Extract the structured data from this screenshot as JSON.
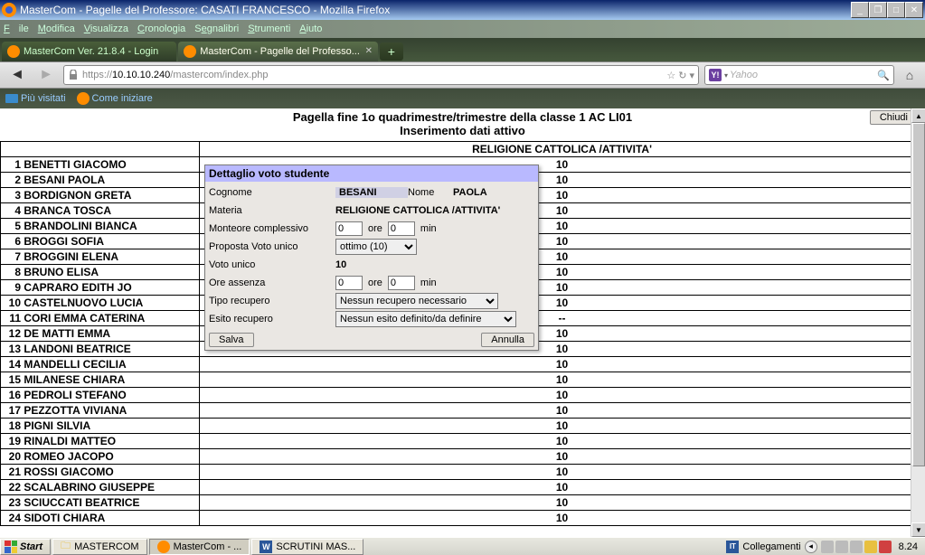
{
  "window": {
    "title": "MasterCom - Pagelle del Professore: CASATI FRANCESCO - Mozilla Firefox"
  },
  "menu": {
    "file": "File",
    "modifica": "Modifica",
    "visualizza": "Visualizza",
    "cronologia": "Cronologia",
    "segnalibri": "Segnalibri",
    "strumenti": "Strumenti",
    "aiuto": "Aiuto"
  },
  "tabs": {
    "t1": "MasterCom Ver. 21.8.4 - Login",
    "t2": "MasterCom - Pagelle del Professo..."
  },
  "nav": {
    "url_pre": "https://",
    "url_bold": "10.10.10.240",
    "url_post": "/mastercom/index.php",
    "search_engine": "Yahoo"
  },
  "bookmarks": {
    "most": "Più visitati",
    "start": "Come iniziare"
  },
  "page": {
    "title1": "Pagella fine 1o quadrimestre/trimestre della classe 1 AC LI01",
    "title2": "Inserimento dati attivo",
    "close_btn": "Chiudi",
    "col_header": "RELIGIONE CATTOLICA /ATTIVITA'",
    "students": [
      {
        "n": "1",
        "name": "BENETTI GIACOMO",
        "v": "10"
      },
      {
        "n": "2",
        "name": "BESANI PAOLA",
        "v": "10"
      },
      {
        "n": "3",
        "name": "BORDIGNON GRETA",
        "v": "10"
      },
      {
        "n": "4",
        "name": "BRANCA TOSCA",
        "v": "10"
      },
      {
        "n": "5",
        "name": "BRANDOLINI BIANCA",
        "v": "10"
      },
      {
        "n": "6",
        "name": "BROGGI SOFIA",
        "v": "10"
      },
      {
        "n": "7",
        "name": "BROGGINI ELENA",
        "v": "10"
      },
      {
        "n": "8",
        "name": "BRUNO ELISA",
        "v": "10"
      },
      {
        "n": "9",
        "name": "CAPRARO EDITH JO",
        "v": "10"
      },
      {
        "n": "10",
        "name": "CASTELNUOVO LUCIA",
        "v": "10"
      },
      {
        "n": "11",
        "name": "CORI EMMA CATERINA",
        "v": "--"
      },
      {
        "n": "12",
        "name": "DE MATTI EMMA",
        "v": "10"
      },
      {
        "n": "13",
        "name": "LANDONI BEATRICE",
        "v": "10"
      },
      {
        "n": "14",
        "name": "MANDELLI CECILIA",
        "v": "10"
      },
      {
        "n": "15",
        "name": "MILANESE CHIARA",
        "v": "10"
      },
      {
        "n": "16",
        "name": "PEDROLI STEFANO",
        "v": "10"
      },
      {
        "n": "17",
        "name": "PEZZOTTA VIVIANA",
        "v": "10"
      },
      {
        "n": "18",
        "name": "PIGNI SILVIA",
        "v": "10"
      },
      {
        "n": "19",
        "name": "RINALDI MATTEO",
        "v": "10"
      },
      {
        "n": "20",
        "name": "ROMEO JACOPO",
        "v": "10"
      },
      {
        "n": "21",
        "name": "ROSSI GIACOMO",
        "v": "10"
      },
      {
        "n": "22",
        "name": "SCALABRINO GIUSEPPE",
        "v": "10"
      },
      {
        "n": "23",
        "name": "SCIUCCATI BEATRICE",
        "v": "10"
      },
      {
        "n": "24",
        "name": "SIDOTI CHIARA",
        "v": "10"
      }
    ]
  },
  "dialog": {
    "title": "Dettaglio voto studente",
    "cognome_lbl": "Cognome",
    "cognome_val": "BESANI",
    "nome_lbl": "Nome",
    "nome_val": "PAOLA",
    "materia_lbl": "Materia",
    "materia_val": "RELIGIONE CATTOLICA /ATTIVITA'",
    "monteore_lbl": "Monteore complessivo",
    "ore_val": "0",
    "ore_lbl": "ore",
    "min_val": "0",
    "min_lbl": "min",
    "proposta_lbl": "Proposta Voto unico",
    "proposta_val": "ottimo (10)",
    "voto_lbl": "Voto unico",
    "voto_val": "10",
    "assenza_lbl": "Ore assenza",
    "assenza_ore": "0",
    "assenza_min": "0",
    "tipo_lbl": "Tipo recupero",
    "tipo_val": "Nessun recupero necessario",
    "esito_lbl": "Esito recupero",
    "esito_val": "Nessun esito definito/da definire",
    "salva": "Salva",
    "annulla": "Annulla"
  },
  "taskbar": {
    "start": "Start",
    "t1": "MASTERCOM",
    "t2": "MasterCom - ...",
    "t3": "SCRUTINI MAS...",
    "links": "Collegamenti",
    "clock": "8.24"
  }
}
